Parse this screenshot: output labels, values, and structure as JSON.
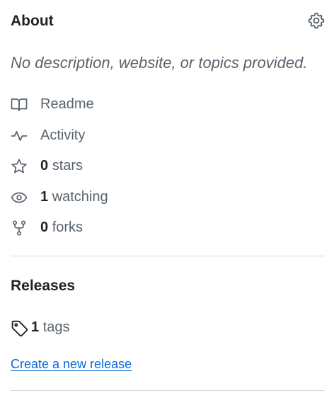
{
  "about": {
    "title": "About",
    "description": "No description, website, or topics provided.",
    "items": [
      {
        "icon": "book-icon",
        "label": "Readme"
      },
      {
        "icon": "pulse-icon",
        "label": "Activity"
      },
      {
        "icon": "star-icon",
        "count": "0",
        "label": "stars"
      },
      {
        "icon": "eye-icon",
        "count": "1",
        "label": "watching"
      },
      {
        "icon": "fork-icon",
        "count": "0",
        "label": "forks"
      }
    ]
  },
  "releases": {
    "title": "Releases",
    "tags_count": "1",
    "tags_label": "tags",
    "create_link": "Create a new release"
  },
  "colors": {
    "text": "#1f2328",
    "muted": "#59636e",
    "link": "#0969da",
    "border": "#d1d9e0"
  }
}
